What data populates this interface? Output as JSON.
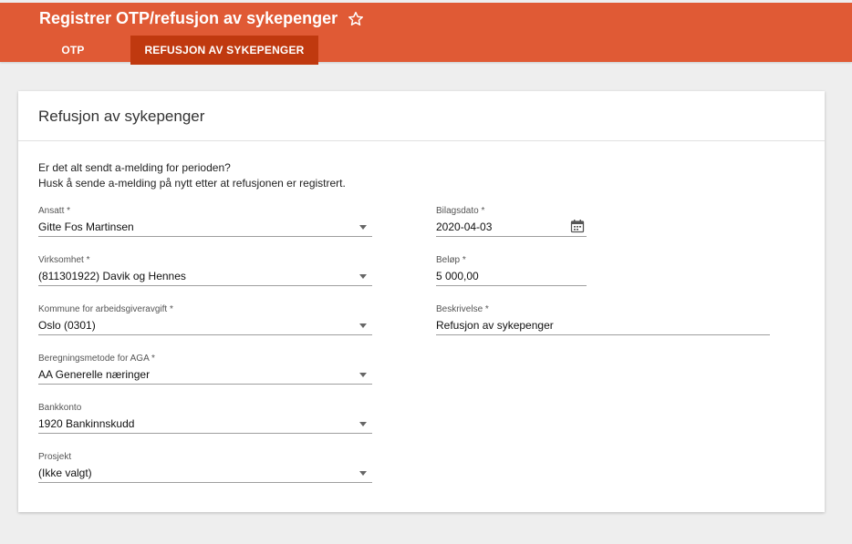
{
  "header": {
    "title": "Registrer OTP/refusjon av sykepenger",
    "tabs": [
      {
        "label": "OTP"
      },
      {
        "label": "REFUSJON AV SYKEPENGER"
      }
    ]
  },
  "card": {
    "title": "Refusjon av sykepenger",
    "notice_line1": "Er det alt sendt a-melding for perioden?",
    "notice_line2": "Husk å sende a-melding på nytt etter at refusjonen er registrert."
  },
  "fields": {
    "ansatt": {
      "label": "Ansatt *",
      "value": "Gitte Fos Martinsen"
    },
    "virksomhet": {
      "label": "Virksomhet *",
      "value": "(811301922) Davik og Hennes"
    },
    "kommune": {
      "label": "Kommune for arbeidsgiveravgift *",
      "value": "Oslo (0301)"
    },
    "beregningsmetode": {
      "label": "Beregningsmetode for AGA *",
      "value": "AA Generelle næringer"
    },
    "bankkonto": {
      "label": "Bankkonto",
      "value": "1920 Bankinnskudd"
    },
    "prosjekt": {
      "label": "Prosjekt",
      "value": "(Ikke valgt)"
    },
    "bilagsdato": {
      "label": "Bilagsdato *",
      "value": "2020-04-03"
    },
    "belop": {
      "label": "Beløp *",
      "value": "5 000,00"
    },
    "beskrivelse": {
      "label": "Beskrivelse *",
      "value": "Refusjon av sykepenger"
    }
  },
  "colors": {
    "header_bg": "#e05a35",
    "active_tab_bg": "#c0390f"
  }
}
